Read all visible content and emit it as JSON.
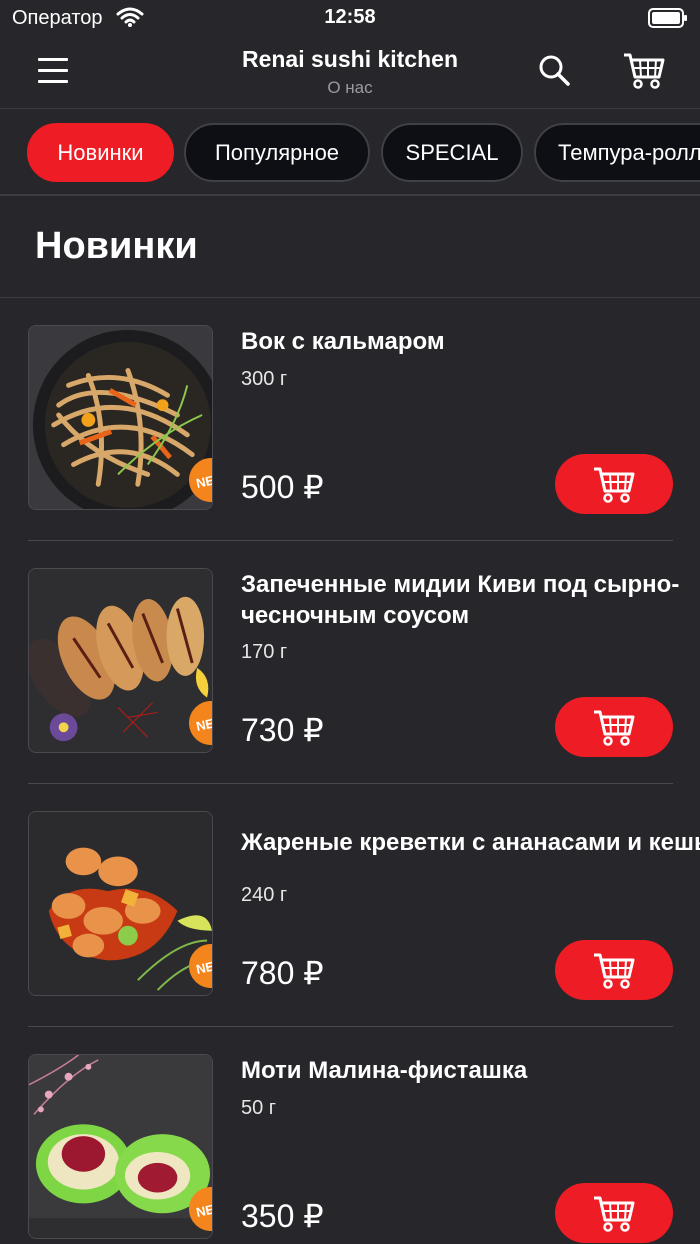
{
  "status_bar": {
    "carrier": "Оператор",
    "time": "12:58"
  },
  "header": {
    "title": "Renai sushi kitchen",
    "subtitle": "О нас"
  },
  "categories": [
    {
      "label": "Новинки",
      "active": true
    },
    {
      "label": "Популярное",
      "active": false
    },
    {
      "label": "SPECIAL",
      "active": false
    },
    {
      "label": "Темпура-роллы",
      "active": false
    }
  ],
  "section": {
    "title": "Новинки"
  },
  "products": [
    {
      "name": "Вок с кальмаром",
      "weight": "300 г",
      "price": "500 ₽",
      "badge": "NEW",
      "image": "noodles"
    },
    {
      "name": "Запеченные мидии Киви под сырно-",
      "name2": "чесночным соусом",
      "weight": "170 г",
      "price": "730 ₽",
      "badge": "NEW",
      "image": "mussels"
    },
    {
      "name": "Жареные креветки с ананасами и кешью",
      "weight": "240 г",
      "price": "780 ₽",
      "badge": "NEW",
      "image": "shrimp"
    },
    {
      "name": "Моти Малина-фисташка",
      "weight": "50 г",
      "price": "350 ₽",
      "badge": "NEW",
      "image": "mochi"
    }
  ],
  "colors": {
    "accent": "#ee1c25",
    "badge": "#f4841c",
    "background": "#26262b"
  }
}
